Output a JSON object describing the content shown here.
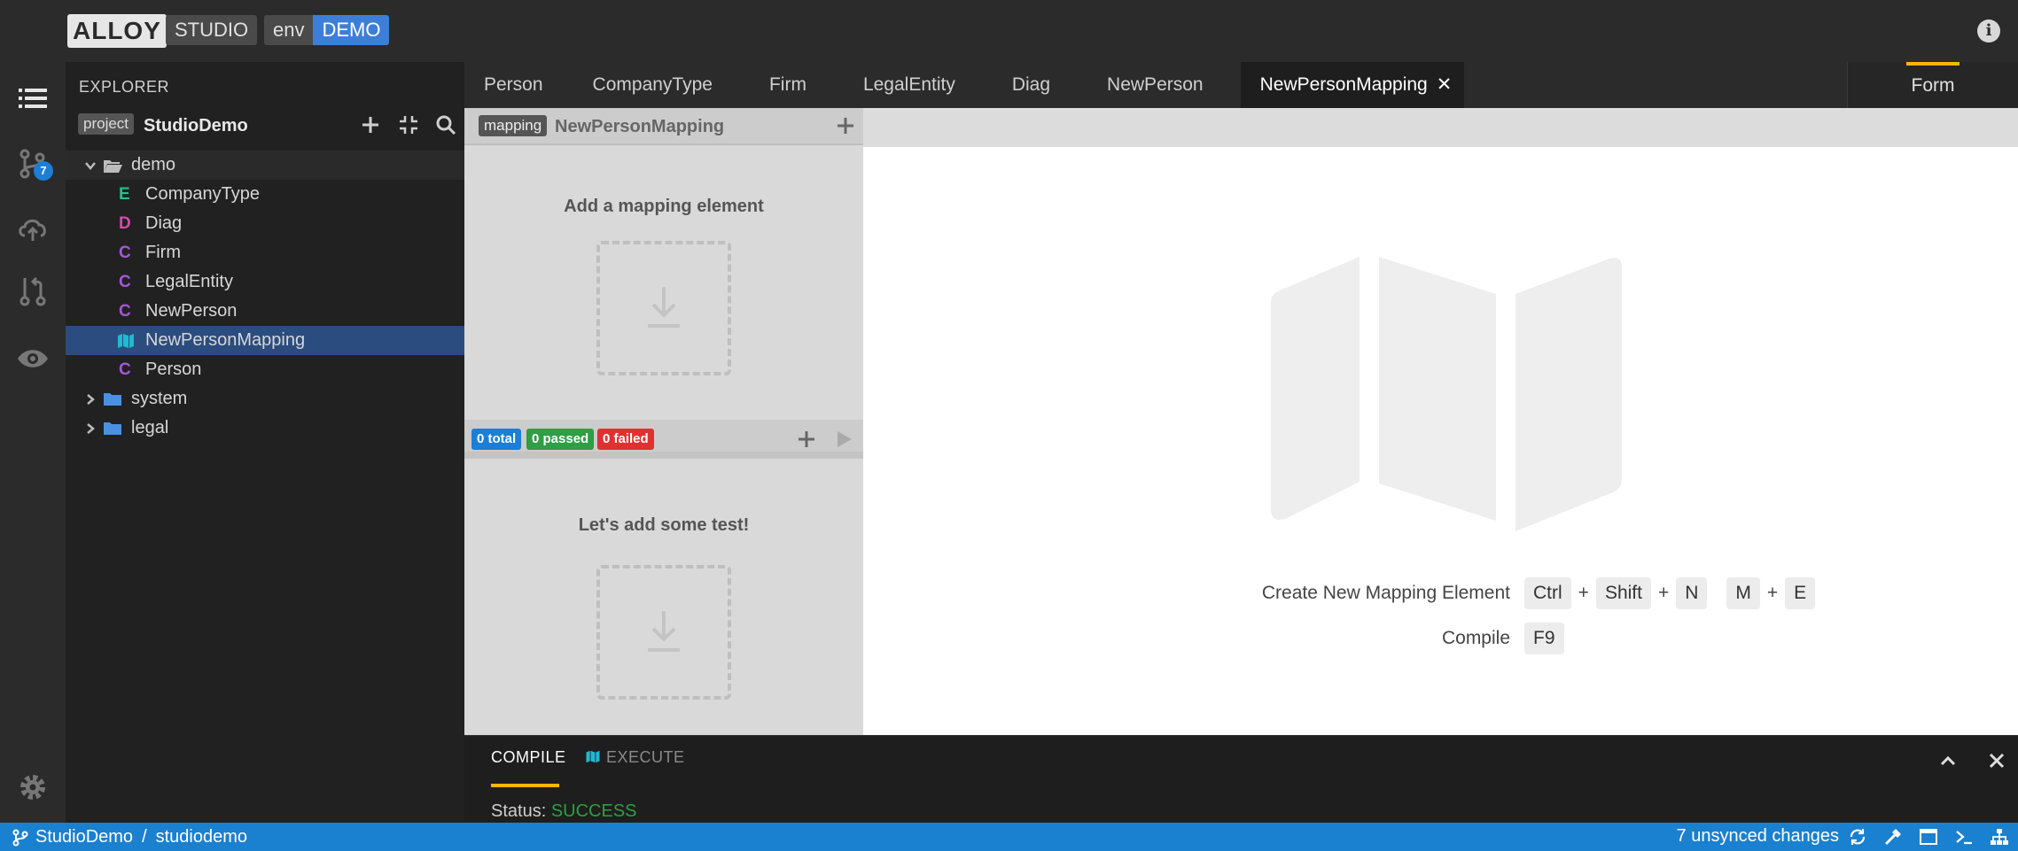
{
  "header": {
    "logo_text": "ALLOY",
    "studio_label": "STUDIO",
    "env_label": "env",
    "env_value": "DEMO",
    "info_glyph": "i"
  },
  "activity": {
    "source_control_badge": "7",
    "icons": [
      "explorer-icon",
      "source-control-icon",
      "cloud-upload-icon",
      "review-icon",
      "eye-icon",
      "gear-icon"
    ]
  },
  "explorer": {
    "title": "EXPLORER",
    "project_badge": "project",
    "project_name": "StudioDemo",
    "tree": [
      {
        "label": "demo",
        "type": "folder",
        "open": true
      },
      {
        "label": "CompanyType",
        "kind": "E",
        "kind_color": "#23c18b"
      },
      {
        "label": "Diag",
        "kind": "D",
        "kind_color": "#d04fa6"
      },
      {
        "label": "Firm",
        "kind": "C",
        "kind_color": "#a259d9"
      },
      {
        "label": "LegalEntity",
        "kind": "C",
        "kind_color": "#a259d9"
      },
      {
        "label": "NewPerson",
        "kind": "C",
        "kind_color": "#a259d9"
      },
      {
        "label": "NewPersonMapping",
        "kind": "map",
        "selected": true
      },
      {
        "label": "Person",
        "kind": "C",
        "kind_color": "#a259d9"
      },
      {
        "label": "system",
        "type": "folder",
        "open": false
      },
      {
        "label": "legal",
        "type": "folder",
        "open": false
      }
    ]
  },
  "tabs": [
    {
      "label": "Person"
    },
    {
      "label": "CompanyType"
    },
    {
      "label": "Firm"
    },
    {
      "label": "LegalEntity"
    },
    {
      "label": "Diag"
    },
    {
      "label": "NewPerson"
    },
    {
      "label": "NewPersonMapping",
      "active": true
    }
  ],
  "tab_close_glyph": "✕",
  "mode_tab": {
    "label": "Form"
  },
  "mapping_panel": {
    "badge": "mapping",
    "name": "NewPersonMapping",
    "empty_title": "Add a mapping element",
    "tests": {
      "total": "0 total",
      "passed": "0 passed",
      "failed": "0 failed"
    },
    "tests_empty_title": "Let's add some test!"
  },
  "editor": {
    "shortcuts": [
      {
        "label": "Create New Mapping Element",
        "keys": [
          "Ctrl",
          "+",
          "Shift",
          "+",
          "N",
          "",
          "M",
          "+",
          "E"
        ]
      },
      {
        "label": "Compile",
        "keys": [
          "F9"
        ]
      }
    ]
  },
  "bottom_panel": {
    "compile_tab": "COMPILE",
    "execute_tab": "EXECUTE",
    "status_label": "Status:",
    "status_value": "SUCCESS"
  },
  "statusbar": {
    "project": "StudioDemo",
    "separator": "/",
    "workspace": "studiodemo",
    "changes": "7 unsynced changes"
  }
}
